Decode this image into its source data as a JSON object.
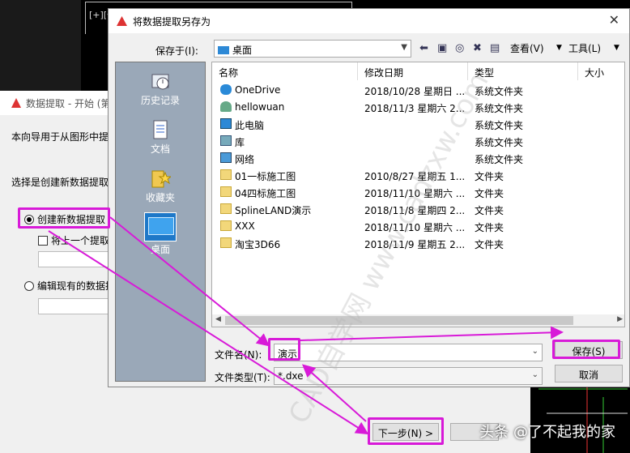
{
  "cad": {
    "label": "[+][俯]"
  },
  "wizard": {
    "title": "数据提取 - 开始 (第",
    "intro": "本向导用于从图形中提",
    "question": "选择是创建新数据提取",
    "radio_new": "创建新数据提取",
    "checkbox_prev": "将上一个提取",
    "radio_edit": "编辑现有的数据提",
    "next_button": "下一步(N) >"
  },
  "dialog": {
    "title": "将数据提取另存为",
    "save_in_label": "保存于(I):",
    "save_in_value": "桌面",
    "view_label": "查看(V)",
    "tools_label": "工具(L)",
    "places": [
      "历史记录",
      "文档",
      "收藏夹",
      "桌面"
    ],
    "columns": [
      "名称",
      "修改日期",
      "类型",
      "大小"
    ],
    "files": [
      {
        "name": "OneDrive",
        "date": "2018/10/28 星期日 ...",
        "type": "系统文件夹",
        "icon": "onedrive-icon"
      },
      {
        "name": "hellowuan",
        "date": "2018/11/3 星期六 2...",
        "type": "系统文件夹",
        "icon": "user-icon"
      },
      {
        "name": "此电脑",
        "date": "",
        "type": "系统文件夹",
        "icon": "computer-icon"
      },
      {
        "name": "库",
        "date": "",
        "type": "系统文件夹",
        "icon": "library-icon"
      },
      {
        "name": "网络",
        "date": "",
        "type": "系统文件夹",
        "icon": "network-icon"
      },
      {
        "name": "01一标施工图",
        "date": "2010/8/27 星期五 1...",
        "type": "文件夹",
        "icon": "folder-icon"
      },
      {
        "name": "04四标施工图",
        "date": "2018/11/10 星期六 ...",
        "type": "文件夹",
        "icon": "folder-icon"
      },
      {
        "name": "SplineLAND演示",
        "date": "2018/11/8 星期四 2...",
        "type": "文件夹",
        "icon": "folder-icon"
      },
      {
        "name": "XXX",
        "date": "2018/11/10 星期六 ...",
        "type": "文件夹",
        "icon": "folder-icon"
      },
      {
        "name": "淘宝3D66",
        "date": "2018/11/9 星期五 2...",
        "type": "文件夹",
        "icon": "folder-icon"
      }
    ],
    "filename_label": "文件名(N):",
    "filename_value": "演示",
    "filetype_label": "文件类型(T):",
    "filetype_value": "*.dxe",
    "save_button": "保存(S)",
    "cancel_button": "取消"
  },
  "watermark": "CAD自学网 www.cadzxw.com",
  "footer_mark": "头条 @了不起我的家"
}
